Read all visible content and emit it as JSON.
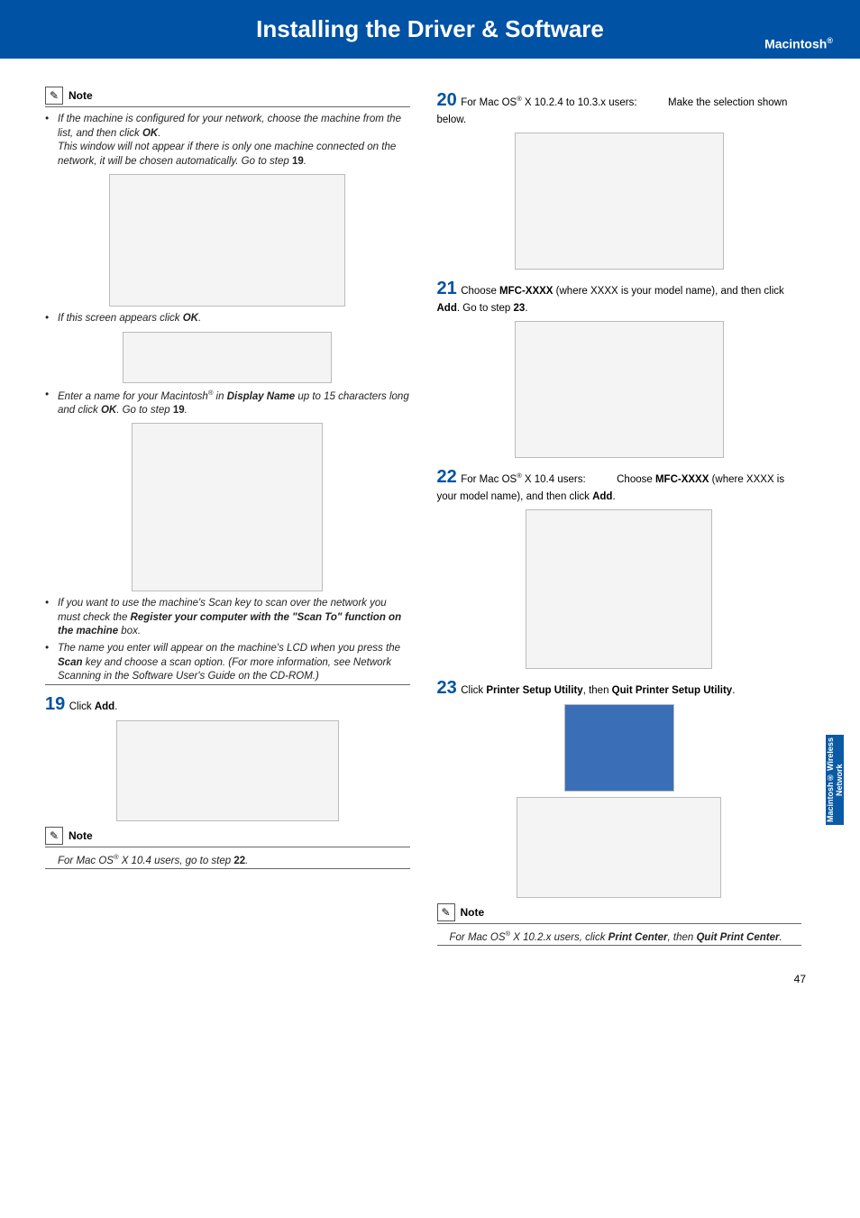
{
  "header": {
    "title": "Installing the Driver & Software",
    "platform": "Macintosh"
  },
  "sidebar_tab": "Macintosh® Wireless Network",
  "page_number": "47",
  "col1": {
    "note1_label": "Note",
    "note1_b1": "If the machine is configured for your network, choose the machine from the list, and then click ",
    "note1_b1b": "OK",
    "note1_b1c": ".",
    "note1_b2a": "This window will not appear if there is only one machine connected on the network, it will be chosen automatically. Go to step ",
    "note1_b2b": "19",
    "note1_b2c": ".",
    "note1_b3a": "If this screen appears click ",
    "note1_b3b": "OK",
    "note1_b3c": ".",
    "note1_b4a": "Enter a name for your Macintosh",
    "note1_b4b": " in ",
    "note1_b4c": "Display Name",
    "note1_b4d": " up to 15 characters long and click ",
    "note1_b4e": "OK",
    "note1_b4f": ". Go to step ",
    "note1_b4g": "19",
    "note1_b4h": ".",
    "note1_b5a": "If you want to use the machine's Scan key to scan over the network you must check the ",
    "note1_b5b": "Register your computer with the \"Scan To\" function on the machine",
    "note1_b5c": " box.",
    "note1_b6a": "The name you enter will appear on the machine's LCD when you press the ",
    "note1_b6b": "Scan",
    "note1_b6c": " key and choose a scan option. (For more information, see Network Scanning in the Software User's Guide on the CD-ROM.)",
    "step19_num": "19",
    "step19_a": " Click ",
    "step19_b": "Add",
    "step19_c": ".",
    "note2_label": "Note",
    "note2_a": "For Mac OS",
    "note2_b": " X 10.4 users, go to step ",
    "note2_c": "22",
    "note2_d": "."
  },
  "col2": {
    "step20_num": "20",
    "step20_a": " For Mac OS",
    "step20_b": " X 10.2.4 to 10.3.x users:",
    "step20_c": "Make the selection shown below.",
    "step21_num": "21",
    "step21_a": " Choose ",
    "step21_b": "MFC-XXXX",
    "step21_c": " (where XXXX is your model name), and then click ",
    "step21_d": "Add",
    "step21_e": ". Go to step ",
    "step21_f": "23",
    "step21_g": ".",
    "step22_num": "22",
    "step22_a": " For Mac OS",
    "step22_b": " X 10.4 users:",
    "step22_c": "Choose ",
    "step22_d": "MFC-XXXX",
    "step22_e": " (where XXXX is your model name), and then click ",
    "step22_f": "Add",
    "step22_g": ".",
    "step23_num": "23",
    "step23_a": " Click ",
    "step23_b": "Printer Setup Utility",
    "step23_c": ", then ",
    "step23_d": "Quit Printer Setup Utility",
    "step23_e": ".",
    "note3_label": "Note",
    "note3_a": "For ",
    "note3_b": "Mac OS",
    "note3_c": " X 10.2.x users, click ",
    "note3_d": "Print Center",
    "note3_e": ", then ",
    "note3_f": "Quit Print Center",
    "note3_g": "."
  }
}
